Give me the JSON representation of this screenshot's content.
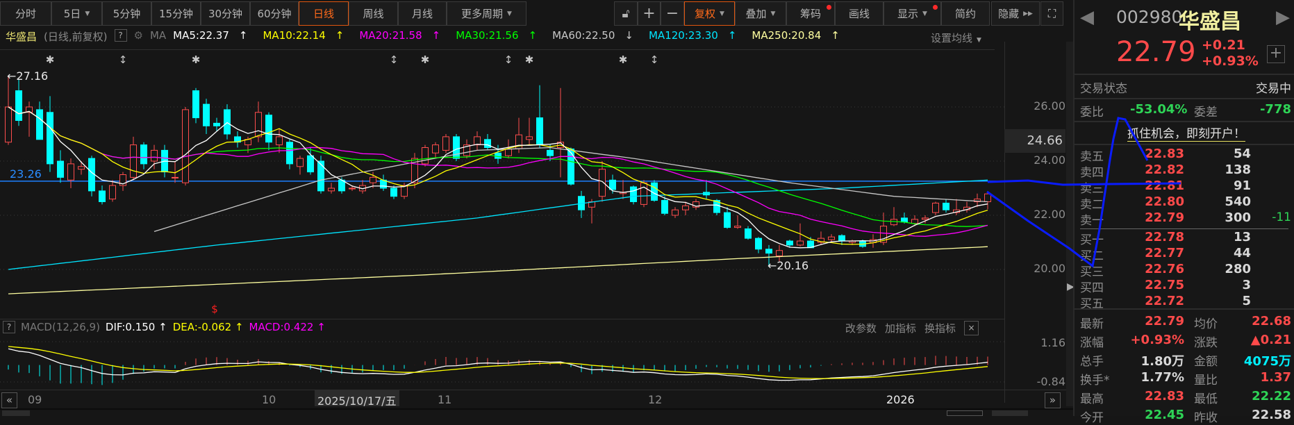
{
  "toolbar": {
    "periods": [
      "分时",
      "5日",
      "5分钟",
      "15分钟",
      "30分钟",
      "60分钟",
      "日线",
      "周线",
      "月线",
      "更多周期"
    ],
    "active_period": "日线",
    "tools": [
      "复权",
      "叠加",
      "筹码",
      "画线",
      "显示",
      "简约",
      "隐藏"
    ],
    "active_tool": "复权"
  },
  "chart_header": {
    "name": "华盛昌",
    "mode": "(日线,前复权)",
    "help": "?",
    "ma_label": "MA",
    "ma": [
      {
        "text": "MA5:22.37",
        "arrow": "↑",
        "color": "#ffffff"
      },
      {
        "text": "MA10:22.14",
        "arrow": "↑",
        "color": "#ffff00"
      },
      {
        "text": "MA20:21.58",
        "arrow": "↑",
        "color": "#ff00ff"
      },
      {
        "text": "MA30:21.56",
        "arrow": "↑",
        "color": "#00ff00"
      },
      {
        "text": "MA60:22.50",
        "arrow": "↓",
        "color": "#c8c8c8"
      },
      {
        "text": "MA120:23.30",
        "arrow": "↑",
        "color": "#00e5ff"
      },
      {
        "text": "MA250:20.84",
        "arrow": "↑",
        "color": "#ffffa0"
      }
    ],
    "set_ma": "设置均线"
  },
  "price_axis": {
    "ticks": [
      "26.00",
      "24.00",
      "22.00",
      "20.00"
    ],
    "highlight": "24.66"
  },
  "annotations": {
    "high": "27.16",
    "low": "20.16",
    "hline": "23.26",
    "marker_s": "$"
  },
  "macd_header": {
    "help": "?",
    "name": "MACD(12,26,9)",
    "dif": "DIF:0.150",
    "dea": "DEA:-0.062",
    "macd": "MACD:0.422",
    "arrow": "↑",
    "actions": [
      "改参数",
      "加指标",
      "换指标"
    ],
    "axis": [
      "1.16",
      "-0.84"
    ]
  },
  "time_axis": {
    "labels": [
      "09",
      "10",
      "11",
      "12",
      "2026"
    ],
    "cursor": "2025/10/17/五"
  },
  "colors": {
    "up": "#ff4d4d",
    "down": "#00ffff",
    "accent": "#ff6a1a",
    "hline": "#1e7fff"
  },
  "chart_data": {
    "type": "candlestick",
    "title": "华盛昌 日线 前复权",
    "ylim": [
      18.3,
      27.6
    ],
    "markers": [
      "✱",
      "↕",
      "✱",
      "↕",
      "✱",
      "↕",
      "✱",
      "✱",
      "↕"
    ],
    "marker_index": [
      4,
      11,
      18,
      37,
      40,
      48,
      50,
      59,
      62
    ],
    "ohlc": [
      [
        24.7,
        27.16,
        24.6,
        26.0
      ],
      [
        26.6,
        27.0,
        25.3,
        25.5
      ],
      [
        25.8,
        26.2,
        24.9,
        26.0
      ],
      [
        25.9,
        26.2,
        24.8,
        24.8
      ],
      [
        25.8,
        26.4,
        23.6,
        23.9
      ],
      [
        24.0,
        24.4,
        23.2,
        23.4
      ],
      [
        23.3,
        24.1,
        23.0,
        23.9
      ],
      [
        23.7,
        24.0,
        23.5,
        23.8
      ],
      [
        24.1,
        24.2,
        22.7,
        22.9
      ],
      [
        22.9,
        23.1,
        22.4,
        22.5
      ],
      [
        22.6,
        23.3,
        22.5,
        23.1
      ],
      [
        23.1,
        23.6,
        22.9,
        23.5
      ],
      [
        23.4,
        24.9,
        23.3,
        24.6
      ],
      [
        24.6,
        24.7,
        23.7,
        23.9
      ],
      [
        24.0,
        24.6,
        23.7,
        24.4
      ],
      [
        24.4,
        24.6,
        23.4,
        23.6
      ],
      [
        23.4,
        24.0,
        23.2,
        23.4
      ],
      [
        23.2,
        26.0,
        23.1,
        25.9
      ],
      [
        26.6,
        26.7,
        25.4,
        25.6
      ],
      [
        26.1,
        26.3,
        25.0,
        25.3
      ],
      [
        25.4,
        25.6,
        25.1,
        25.3
      ],
      [
        25.9,
        26.1,
        24.8,
        25.0
      ],
      [
        24.9,
        25.1,
        24.5,
        24.7
      ],
      [
        24.6,
        24.9,
        24.3,
        24.8
      ],
      [
        24.9,
        26.2,
        24.7,
        25.8
      ],
      [
        25.7,
        25.8,
        24.4,
        24.7
      ],
      [
        24.6,
        25.2,
        24.3,
        24.9
      ],
      [
        24.7,
        24.8,
        23.7,
        23.9
      ],
      [
        23.8,
        24.2,
        23.5,
        24.1
      ],
      [
        24.2,
        24.5,
        23.5,
        23.6
      ],
      [
        24.0,
        24.2,
        22.8,
        22.9
      ],
      [
        22.9,
        23.2,
        22.8,
        23.0
      ],
      [
        23.3,
        23.4,
        22.8,
        22.9
      ],
      [
        23.0,
        23.1,
        22.9,
        23.0
      ],
      [
        22.9,
        23.3,
        22.8,
        23.1
      ],
      [
        23.2,
        23.6,
        23.0,
        23.4
      ],
      [
        23.3,
        23.5,
        22.9,
        23.0
      ],
      [
        23.0,
        23.1,
        22.6,
        22.7
      ],
      [
        22.7,
        23.2,
        22.6,
        23.1
      ],
      [
        23.2,
        24.3,
        23.0,
        24.1
      ],
      [
        23.9,
        24.6,
        23.8,
        24.5
      ],
      [
        24.3,
        24.7,
        24.1,
        24.6
      ],
      [
        24.4,
        25.0,
        24.3,
        24.9
      ],
      [
        24.9,
        25.0,
        24.0,
        24.1
      ],
      [
        24.2,
        24.8,
        24.1,
        24.6
      ],
      [
        24.6,
        25.1,
        24.4,
        24.9
      ],
      [
        24.8,
        25.0,
        24.4,
        24.5
      ],
      [
        24.3,
        24.6,
        23.9,
        24.1
      ],
      [
        24.2,
        24.8,
        24.1,
        24.45
      ],
      [
        24.46,
        25.6,
        24.3,
        24.97
      ],
      [
        24.8,
        25.6,
        24.6,
        24.9
      ],
      [
        25.6,
        26.8,
        24.5,
        24.6
      ],
      [
        24.4,
        24.6,
        24.0,
        24.2
      ],
      [
        24.5,
        26.7,
        23.4,
        24.7
      ],
      [
        24.45,
        24.5,
        23.1,
        23.15
      ],
      [
        22.7,
        22.9,
        21.9,
        22.2
      ],
      [
        22.3,
        22.6,
        21.7,
        22.5
      ],
      [
        22.7,
        24.0,
        22.5,
        23.7
      ],
      [
        23.3,
        23.5,
        22.8,
        22.95
      ],
      [
        22.8,
        23.3,
        22.6,
        22.85
      ],
      [
        23.05,
        23.1,
        22.4,
        22.5
      ],
      [
        22.4,
        23.3,
        22.3,
        23.2
      ],
      [
        23.2,
        23.3,
        22.5,
        22.55
      ],
      [
        22.55,
        22.7,
        22.0,
        22.07
      ],
      [
        22.0,
        22.3,
        21.9,
        22.2
      ],
      [
        22.2,
        22.5,
        22.0,
        22.35
      ],
      [
        22.3,
        22.6,
        22.2,
        22.5
      ],
      [
        22.85,
        23.3,
        22.6,
        22.75
      ],
      [
        22.55,
        22.6,
        22.0,
        22.1
      ],
      [
        22.1,
        22.3,
        21.5,
        21.55
      ],
      [
        21.55,
        22.0,
        21.5,
        21.6
      ],
      [
        21.5,
        21.6,
        21.1,
        21.15
      ],
      [
        21.15,
        21.2,
        20.6,
        20.75
      ],
      [
        20.75,
        20.9,
        20.16,
        20.6
      ],
      [
        20.5,
        20.9,
        20.3,
        20.7
      ],
      [
        21.05,
        21.1,
        20.8,
        20.9
      ],
      [
        20.9,
        21.7,
        20.85,
        21.05
      ],
      [
        21.05,
        21.2,
        20.8,
        20.8
      ],
      [
        21.0,
        21.4,
        20.9,
        21.15
      ],
      [
        21.1,
        21.3,
        21.0,
        21.2
      ],
      [
        21.25,
        21.3,
        20.9,
        21.05
      ],
      [
        21.0,
        21.1,
        20.9,
        21.05
      ],
      [
        21.05,
        21.1,
        20.8,
        20.85
      ],
      [
        20.99,
        21.3,
        20.8,
        21.1
      ],
      [
        21.0,
        22.1,
        20.9,
        21.6
      ],
      [
        21.65,
        22.3,
        21.6,
        21.85
      ],
      [
        21.9,
        22.1,
        21.7,
        21.75
      ],
      [
        21.7,
        22.0,
        21.6,
        21.85
      ],
      [
        21.85,
        22.0,
        21.7,
        21.9
      ],
      [
        22.1,
        22.5,
        22.0,
        22.45
      ],
      [
        22.45,
        22.6,
        22.1,
        22.2
      ],
      [
        22.1,
        22.6,
        22.0,
        22.2
      ],
      [
        22.2,
        22.5,
        22.1,
        22.3
      ],
      [
        22.5,
        22.8,
        22.3,
        22.6
      ],
      [
        22.5,
        22.83,
        22.22,
        22.79
      ]
    ],
    "ma_long": {
      "MA60": [
        [
          14,
          21.4
        ],
        [
          30,
          23.3
        ],
        [
          45,
          24.4
        ],
        [
          52,
          24.5
        ],
        [
          60,
          24.1
        ],
        [
          75,
          23.2
        ],
        [
          85,
          22.7
        ],
        [
          94,
          22.5
        ]
      ],
      "MA120": [
        [
          0,
          20.0
        ],
        [
          20,
          20.9
        ],
        [
          45,
          21.9
        ],
        [
          60,
          22.7
        ],
        [
          80,
          23.0
        ],
        [
          94,
          23.3
        ]
      ],
      "MA250": [
        [
          0,
          19.1
        ],
        [
          40,
          19.8
        ],
        [
          70,
          20.4
        ],
        [
          94,
          20.84
        ]
      ]
    },
    "macd_seed": {
      "ema12": 26.3,
      "ema26": 25.4,
      "dea": 0.95
    },
    "macd_ylim": [
      -0.84,
      1.16
    ]
  },
  "quote": {
    "code": "002980",
    "name": "华盛昌",
    "price": "22.79",
    "change": "+0.21",
    "pct": "+0.93%",
    "status_label": "交易状态",
    "status": "交易中",
    "wb_label": "委比",
    "wb": "-53.04%",
    "wc_label": "委差",
    "wc": "-778",
    "ad": "抓住机会，即刻开户！"
  },
  "orderbook": {
    "sell": [
      {
        "label": "卖五",
        "price": "22.83",
        "qty": "54",
        "chg": ""
      },
      {
        "label": "卖四",
        "price": "22.82",
        "qty": "138",
        "chg": ""
      },
      {
        "label": "卖三",
        "price": "22.81",
        "qty": "91",
        "chg": ""
      },
      {
        "label": "卖二",
        "price": "22.80",
        "qty": "540",
        "chg": ""
      },
      {
        "label": "卖一",
        "price": "22.79",
        "qty": "300",
        "chg": "-11"
      }
    ],
    "buy": [
      {
        "label": "买一",
        "price": "22.78",
        "qty": "13",
        "chg": ""
      },
      {
        "label": "买二",
        "price": "22.77",
        "qty": "44",
        "chg": ""
      },
      {
        "label": "买三",
        "price": "22.76",
        "qty": "280",
        "chg": ""
      },
      {
        "label": "买四",
        "price": "22.75",
        "qty": "3",
        "chg": ""
      },
      {
        "label": "买五",
        "price": "22.72",
        "qty": "5",
        "chg": ""
      }
    ]
  },
  "stats": [
    {
      "l1": "最新",
      "v1": "22.79",
      "c1": "red",
      "l2": "均价",
      "v2": "22.68",
      "c2": "red"
    },
    {
      "l1": "涨幅",
      "v1": "+0.93%",
      "c1": "red",
      "l2": "涨跌",
      "v2": "▲0.21",
      "c2": "red"
    },
    {
      "l1": "总手",
      "v1": "1.80万",
      "c1": "wht",
      "l2": "金额",
      "v2": "4075万",
      "c2": "cyn"
    },
    {
      "l1": "换手*",
      "v1": "1.77%",
      "c1": "wht",
      "l2": "量比",
      "v2": "1.37",
      "c2": "red"
    },
    {
      "l1": "最高",
      "v1": "22.83",
      "c1": "red",
      "l2": "最低",
      "v2": "22.22",
      "c2": "grn"
    },
    {
      "l1": "今开",
      "v1": "22.45",
      "c1": "grn",
      "l2": "昨收",
      "v2": "22.58",
      "c2": "wht"
    }
  ]
}
